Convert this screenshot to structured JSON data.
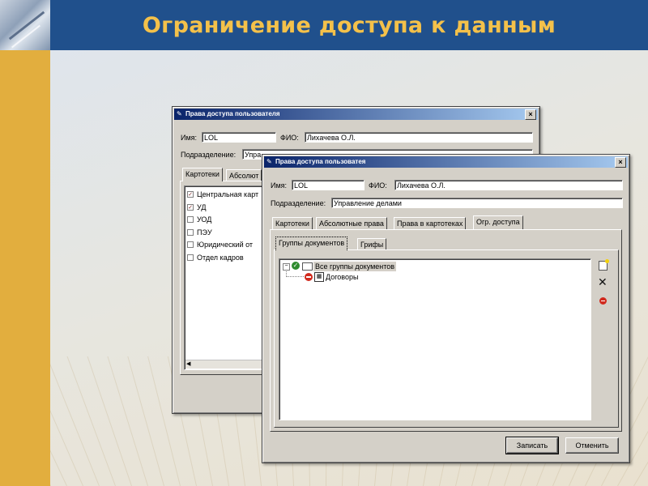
{
  "slide": {
    "title": "Ограничение доступа к данным"
  },
  "back_window": {
    "title": "Права доступа пользователя",
    "close": "×",
    "name_label": "Имя:",
    "name_value": "LOL",
    "fio_label": "ФИО:",
    "fio_value": "Лихачева О.Л.",
    "dept_label": "Подразделение:",
    "dept_value": "Упра",
    "tabs": [
      "Картотеки",
      "Абсолют"
    ],
    "list": [
      {
        "label": "Центральная карт",
        "checked": true
      },
      {
        "label": "УД",
        "checked": true
      },
      {
        "label": "УОД",
        "checked": false
      },
      {
        "label": "ПЭУ",
        "checked": false
      },
      {
        "label": "Юридический от",
        "checked": false
      },
      {
        "label": "Отдел кадров",
        "checked": false
      }
    ]
  },
  "front_window": {
    "title": "Права доступа пользоватея",
    "close": "×",
    "name_label": "Имя:",
    "name_value": "LOL",
    "fio_label": "ФИО:",
    "fio_value": "Лихачева О.Л.",
    "dept_label": "Подразделение:",
    "dept_value": "Управление делами",
    "tabs": [
      "Картотеки",
      "Абсолютные права",
      "Права в картотеках",
      "Огр. доступа"
    ],
    "subtabs": [
      "Группы документов",
      "Грифы"
    ],
    "tree": {
      "root": "Все группы документов",
      "child": "Договоры"
    },
    "buttons": {
      "save": "Записать",
      "cancel": "Отменить"
    }
  }
}
